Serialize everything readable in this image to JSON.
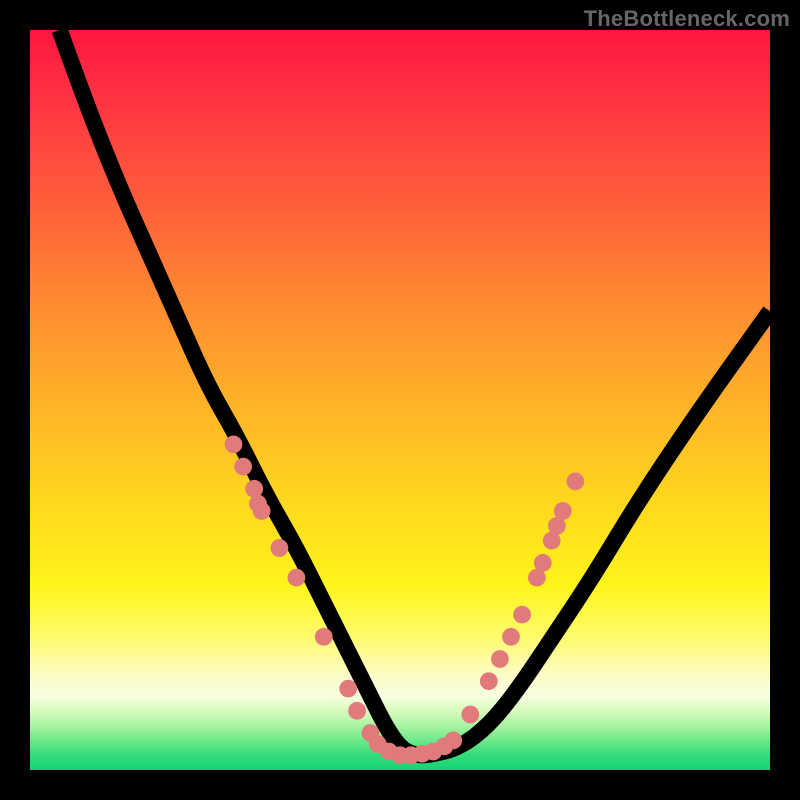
{
  "watermark": "TheBottleneck.com",
  "chart_data": {
    "type": "line",
    "title": "",
    "xlabel": "",
    "ylabel": "",
    "xlim": [
      0,
      100
    ],
    "ylim": [
      0,
      100
    ],
    "grid": false,
    "background_gradient": {
      "orientation": "vertical",
      "stops": [
        {
          "pos": 0.0,
          "color": "#ff163f"
        },
        {
          "pos": 0.08,
          "color": "#ff2f42"
        },
        {
          "pos": 0.22,
          "color": "#ff5a3c"
        },
        {
          "pos": 0.36,
          "color": "#ff8832"
        },
        {
          "pos": 0.5,
          "color": "#ffb128"
        },
        {
          "pos": 0.64,
          "color": "#ffd81e"
        },
        {
          "pos": 0.75,
          "color": "#fff41a"
        },
        {
          "pos": 0.82,
          "color": "#fffb6c"
        },
        {
          "pos": 0.875,
          "color": "#fcfccb"
        },
        {
          "pos": 0.9,
          "color": "#f6fee0"
        },
        {
          "pos": 0.92,
          "color": "#d8fbbd"
        },
        {
          "pos": 0.94,
          "color": "#a8f4a2"
        },
        {
          "pos": 0.96,
          "color": "#6ee989"
        },
        {
          "pos": 0.98,
          "color": "#33dc7c"
        },
        {
          "pos": 1.0,
          "color": "#15d374"
        }
      ]
    },
    "series": [
      {
        "name": "curve",
        "color": "#000000",
        "x": [
          4,
          8,
          12,
          16,
          20,
          24,
          28,
          32,
          36,
          40,
          42,
          44,
          46,
          48,
          50,
          52,
          54,
          58,
          62,
          66,
          70,
          76,
          82,
          90,
          100
        ],
        "y": [
          100,
          89,
          79,
          70,
          61,
          52,
          45,
          37,
          30,
          22,
          18,
          14,
          10,
          6,
          3,
          2,
          2,
          3,
          6,
          11,
          17,
          26,
          36,
          48,
          62
        ]
      }
    ],
    "markers": {
      "color": "#e17a7b",
      "radius": 1.2,
      "points": [
        {
          "x": 27.5,
          "y": 44
        },
        {
          "x": 28.8,
          "y": 41
        },
        {
          "x": 30.3,
          "y": 38
        },
        {
          "x": 30.8,
          "y": 36
        },
        {
          "x": 31.3,
          "y": 35
        },
        {
          "x": 33.7,
          "y": 30
        },
        {
          "x": 36.0,
          "y": 26
        },
        {
          "x": 39.7,
          "y": 18
        },
        {
          "x": 43.0,
          "y": 11
        },
        {
          "x": 44.2,
          "y": 8
        },
        {
          "x": 46.0,
          "y": 5
        },
        {
          "x": 47.0,
          "y": 3.5
        },
        {
          "x": 48.5,
          "y": 2.5
        },
        {
          "x": 50.0,
          "y": 2.0
        },
        {
          "x": 51.5,
          "y": 2.0
        },
        {
          "x": 53.0,
          "y": 2.2
        },
        {
          "x": 54.5,
          "y": 2.5
        },
        {
          "x": 56.0,
          "y": 3.2
        },
        {
          "x": 57.2,
          "y": 4.0
        },
        {
          "x": 59.5,
          "y": 7.5
        },
        {
          "x": 62.0,
          "y": 12
        },
        {
          "x": 63.5,
          "y": 15
        },
        {
          "x": 65.0,
          "y": 18
        },
        {
          "x": 66.5,
          "y": 21
        },
        {
          "x": 68.5,
          "y": 26
        },
        {
          "x": 69.3,
          "y": 28
        },
        {
          "x": 70.5,
          "y": 31
        },
        {
          "x": 71.2,
          "y": 33
        },
        {
          "x": 72.0,
          "y": 35
        },
        {
          "x": 73.7,
          "y": 39
        }
      ]
    }
  }
}
